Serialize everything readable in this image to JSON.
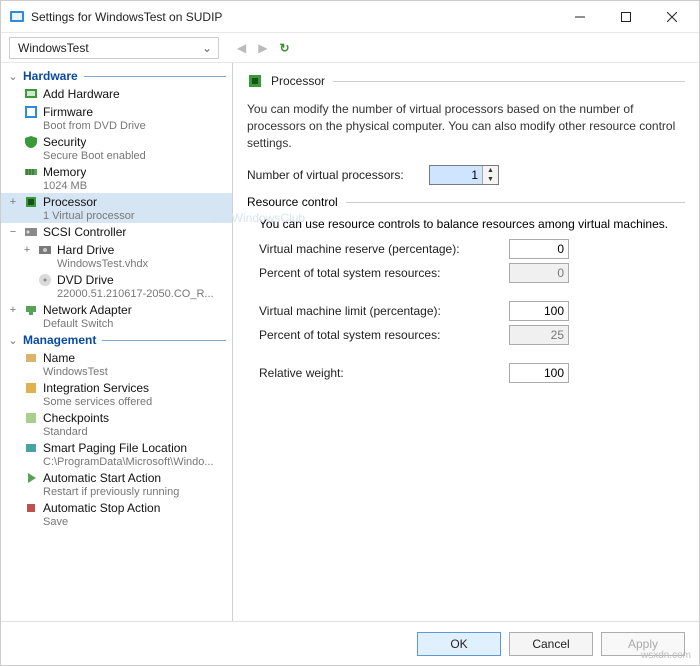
{
  "window": {
    "title": "Settings for WindowsTest on SUDIP"
  },
  "toolbar": {
    "vm_name": "WindowsTest"
  },
  "sidebar": {
    "hardware": "Hardware",
    "management": "Management",
    "items": {
      "add_hardware": "Add Hardware",
      "firmware": "Firmware",
      "firmware_sub": "Boot from DVD Drive",
      "security": "Security",
      "security_sub": "Secure Boot enabled",
      "memory": "Memory",
      "memory_sub": "1024 MB",
      "processor": "Processor",
      "processor_sub": "1 Virtual processor",
      "scsi": "SCSI Controller",
      "hard_drive": "Hard Drive",
      "hard_drive_sub": "WindowsTest.vhdx",
      "dvd": "DVD Drive",
      "dvd_sub": "22000.51.210617-2050.CO_R...",
      "net": "Network Adapter",
      "net_sub": "Default Switch",
      "name": "Name",
      "name_sub": "WindowsTest",
      "integ": "Integration Services",
      "integ_sub": "Some services offered",
      "check": "Checkpoints",
      "check_sub": "Standard",
      "paging": "Smart Paging File Location",
      "paging_sub": "C:\\ProgramData\\Microsoft\\Windo...",
      "asa": "Automatic Start Action",
      "asa_sub": "Restart if previously running",
      "astop": "Automatic Stop Action",
      "astop_sub": "Save"
    }
  },
  "panel": {
    "title": "Processor",
    "desc": "You can modify the number of virtual processors based on the number of processors on the physical computer. You can also modify other resource control settings.",
    "num_label": "Number of virtual processors:",
    "num_value": "1",
    "rc_title": "Resource control",
    "rc_desc": "You can use resource controls to balance resources among virtual machines.",
    "vm_reserve_label": "Virtual machine reserve (percentage):",
    "vm_reserve_value": "0",
    "reserve_pct_label": "Percent of total system resources:",
    "reserve_pct_value": "0",
    "vm_limit_label": "Virtual machine limit (percentage):",
    "vm_limit_value": "100",
    "limit_pct_label": "Percent of total system resources:",
    "limit_pct_value": "25",
    "weight_label": "Relative weight:",
    "weight_value": "100"
  },
  "footer": {
    "ok": "OK",
    "cancel": "Cancel",
    "apply": "Apply"
  },
  "watermarks": {
    "site": "wsxdn.com",
    "brand": "TheWindowsClub"
  }
}
